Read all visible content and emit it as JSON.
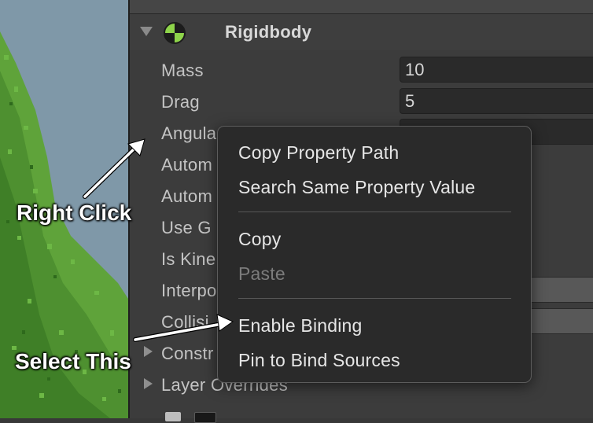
{
  "component": {
    "title": "Rigidbody"
  },
  "properties": [
    {
      "label": "Mass",
      "value": "10"
    },
    {
      "label": "Drag",
      "value": "5"
    },
    {
      "label": "Angula",
      "value": ""
    },
    {
      "label": "Autom",
      "value": ""
    },
    {
      "label": "Autom",
      "value": ""
    },
    {
      "label": "Use G",
      "value": ""
    },
    {
      "label": "Is Kine",
      "value": ""
    },
    {
      "label": "Interpo",
      "value": ""
    },
    {
      "label": "Collisi",
      "value": ""
    },
    {
      "label": "Constr",
      "value": ""
    },
    {
      "label": "Layer Overrides",
      "value": ""
    }
  ],
  "context_menu": {
    "items": [
      {
        "label": "Copy Property Path",
        "enabled": true
      },
      {
        "label": "Search Same Property Value",
        "enabled": true
      },
      {
        "label": "Copy",
        "enabled": true
      },
      {
        "label": "Paste",
        "enabled": false
      },
      {
        "label": "Enable Binding",
        "enabled": true
      },
      {
        "label": "Pin to Bind Sources",
        "enabled": true
      }
    ]
  },
  "annotations": {
    "right_click": "Right Click",
    "select_this": "Select This"
  },
  "icons": {
    "component": "rigidbody-icon",
    "foldout": "triangle-right-icon",
    "fold_open": "triangle-down-icon"
  },
  "colors": {
    "rigidbody_icon": "#8ed44a",
    "menu_background": "#2a2a2a",
    "inspector_background": "#3c3c3c"
  }
}
